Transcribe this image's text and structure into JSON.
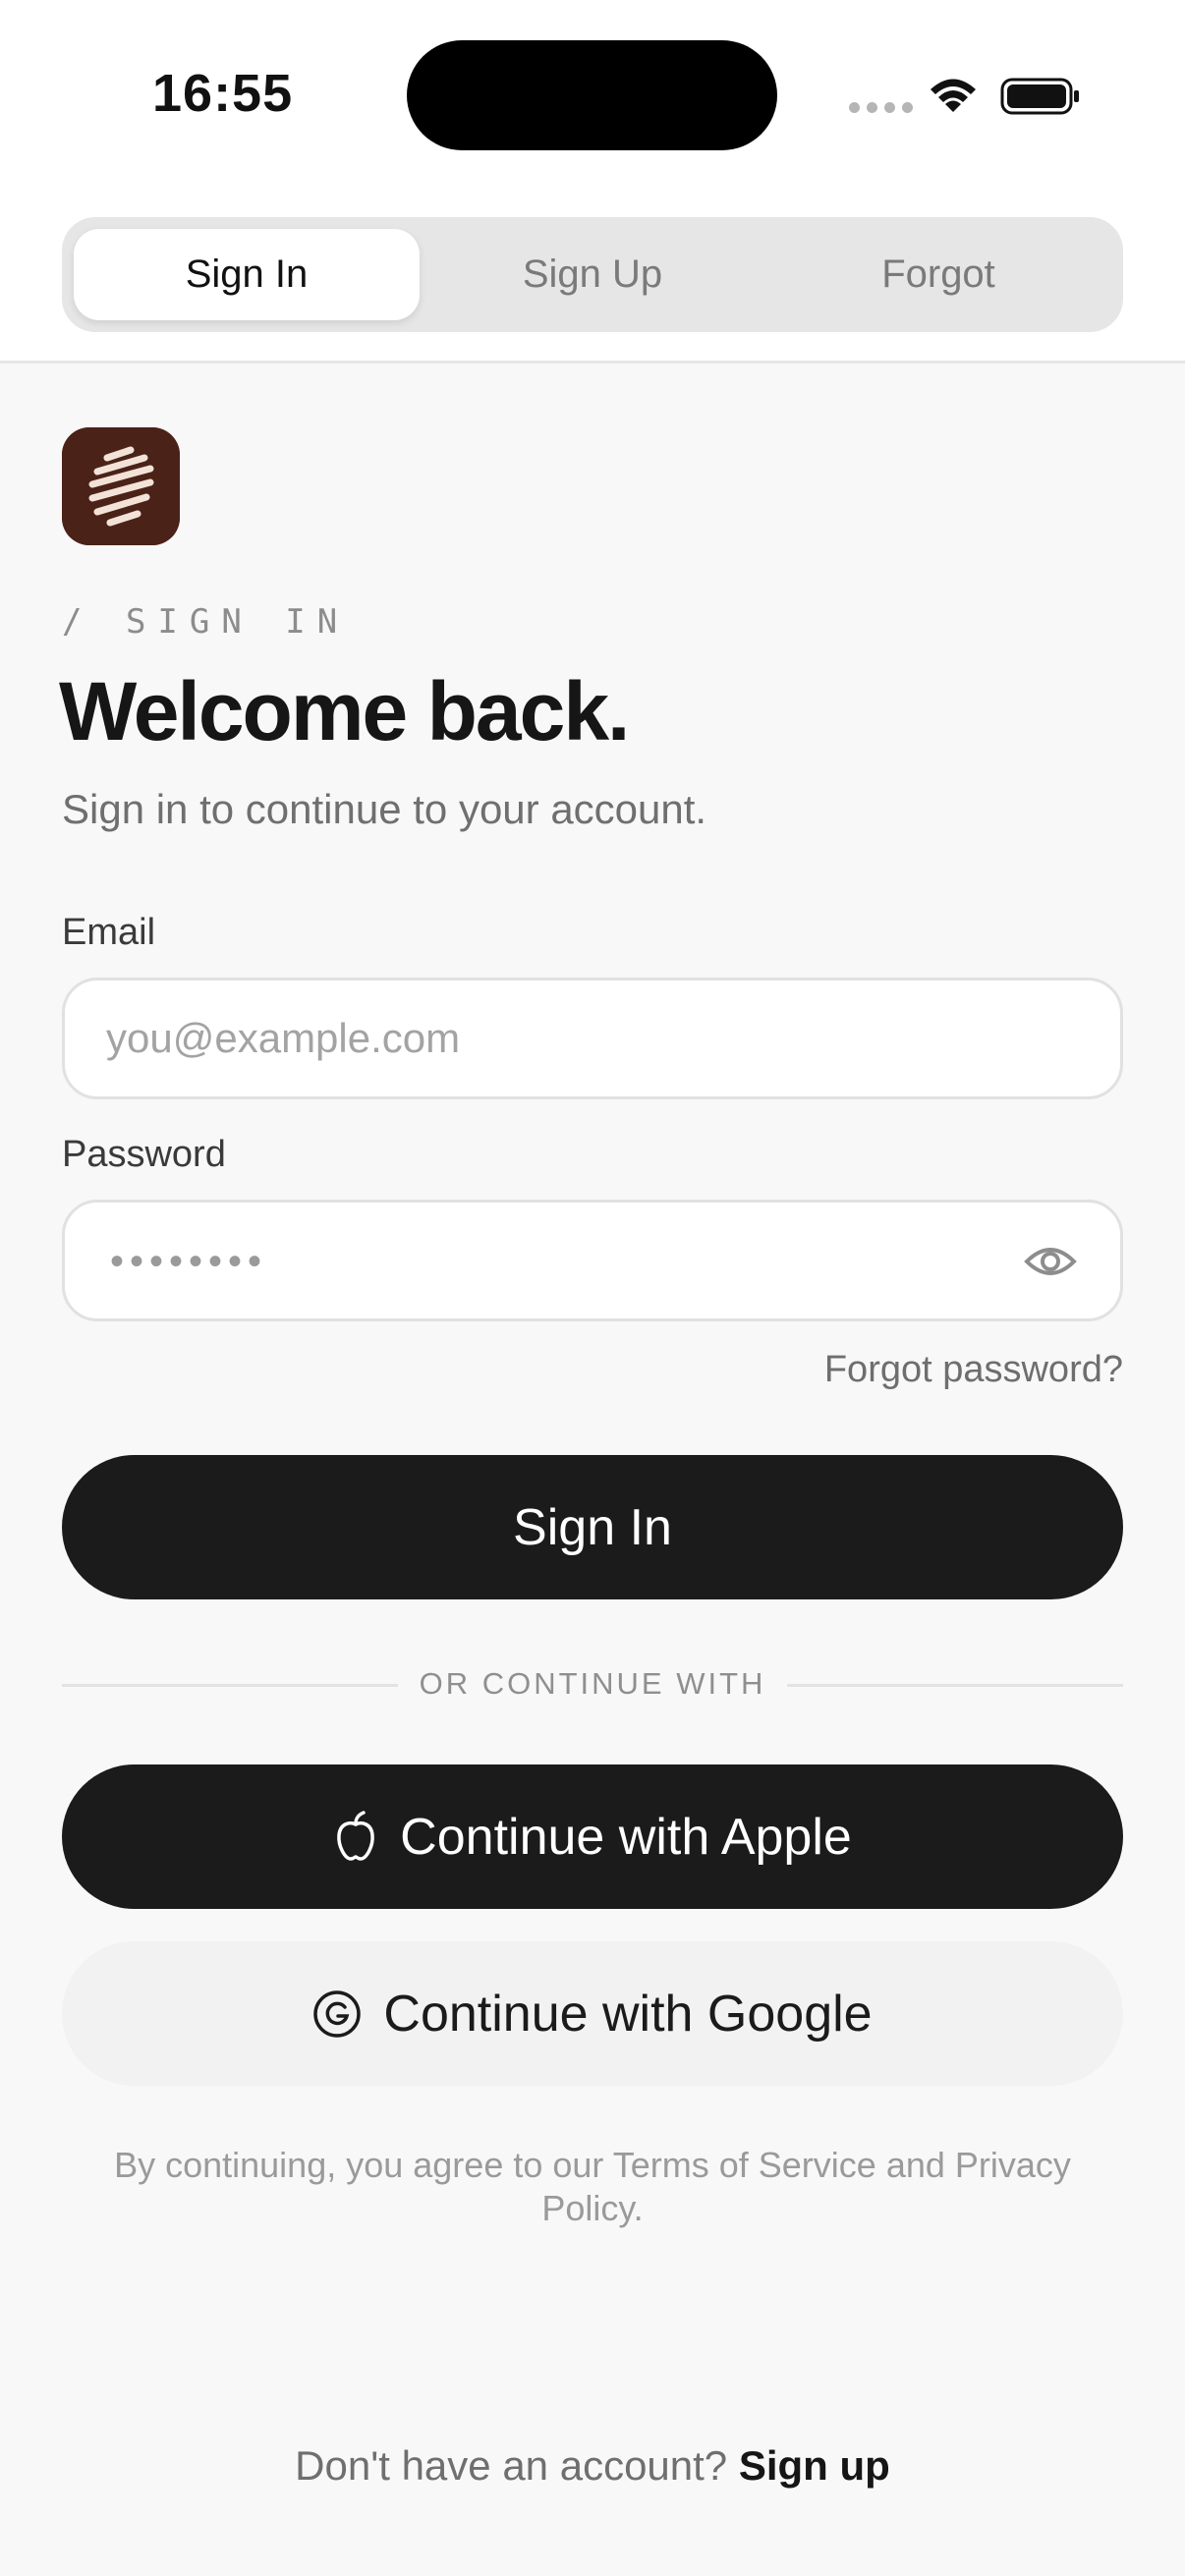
{
  "status_bar": {
    "time": "16:55",
    "wifi_icon": "wifi-icon",
    "battery_icon": "battery-icon"
  },
  "tabs": [
    {
      "label": "Sign In",
      "active": true
    },
    {
      "label": "Sign Up",
      "active": false
    },
    {
      "label": "Forgot",
      "active": false
    }
  ],
  "header": {
    "eyebrow": "/ SIGN IN",
    "title": "Welcome back.",
    "subtitle": "Sign in to continue to your account."
  },
  "form": {
    "email_label": "Email",
    "email_placeholder": "you@example.com",
    "password_label": "Password",
    "password_mask": "••••••••",
    "forgot_link": "Forgot password?",
    "submit_label": "Sign In"
  },
  "social": {
    "divider": "OR CONTINUE WITH",
    "apple_label": "Continue with Apple",
    "google_label": "Continue with Google"
  },
  "terms": "By continuing, you agree to our Terms of Service and Privacy Policy.",
  "footer": {
    "prompt": "Don't have an account?",
    "link": "Sign up"
  },
  "colors": {
    "background": "#f8f8f8",
    "primary_button": "#1b1b1b",
    "logo_background": "#4a2218",
    "logo_stripes": "#f3e2d8"
  }
}
